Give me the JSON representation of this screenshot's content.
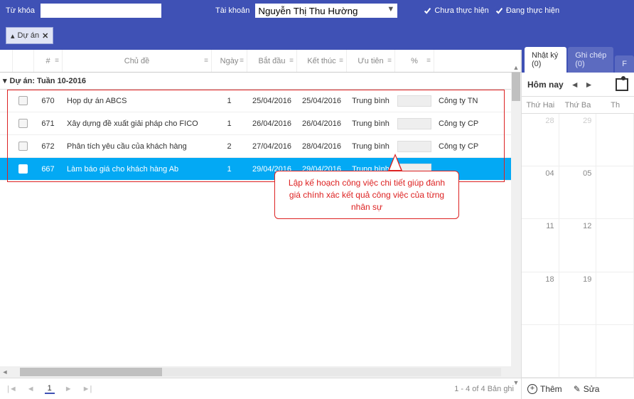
{
  "topbar": {
    "keyword_label": "Từ khóa",
    "keyword_value": "",
    "account_label": "Tài khoản",
    "account_value": "Nguyễn Thị Thu Hường",
    "chk_not_done": "Chưa thực hiện",
    "chk_doing": "Đang thực hiện"
  },
  "group_button": {
    "label": "Dự án",
    "close": "✕"
  },
  "grid": {
    "headers": {
      "id": "#",
      "subject": "Chủ đề",
      "days": "Ngày",
      "start": "Bắt đầu",
      "end": "Kết thúc",
      "priority": "Ưu tiên",
      "pct": "%"
    },
    "group_label": "Dự án: Tuần 10-2016",
    "rows": [
      {
        "id": "670",
        "subject": "Họp dự án ABCS",
        "days": "1",
        "start": "25/04/2016",
        "end": "25/04/2016",
        "priority": "Trung bình",
        "company": "Công ty TN"
      },
      {
        "id": "671",
        "subject": "Xây dựng đề xuất giải pháp cho FICO",
        "days": "1",
        "start": "26/04/2016",
        "end": "26/04/2016",
        "priority": "Trung bình",
        "company": "Công ty CP"
      },
      {
        "id": "672",
        "subject": "Phân tích yêu cầu của khách hàng",
        "days": "2",
        "start": "27/04/2016",
        "end": "28/04/2016",
        "priority": "Trung bình",
        "company": "Công ty CP"
      },
      {
        "id": "667",
        "subject": "Làm báo giá cho khách hàng Ab",
        "days": "1",
        "start": "29/04/2016",
        "end": "29/04/2016",
        "priority": "Trung bình",
        "company": ""
      }
    ]
  },
  "callout": "Lập kế hoạch công việc chi tiết giúp đánh giá chính xác kết quả công việc của từng nhân sự",
  "pager": {
    "current": "1",
    "summary": "1 - 4 of 4 Bản ghi"
  },
  "tabs": {
    "diary": "Nhật ký (0)",
    "notes": "Ghi chép (0)",
    "third": "F"
  },
  "calendar": {
    "today_label": "Hôm nay",
    "day_headers": [
      "Thứ Hai",
      "Thứ Ba",
      "Th"
    ],
    "cells": [
      [
        "28",
        "29",
        ""
      ],
      [
        "04",
        "05",
        ""
      ],
      [
        "11",
        "12",
        ""
      ],
      [
        "18",
        "19",
        ""
      ],
      [
        "",
        "",
        ""
      ]
    ],
    "muted_row": 0
  },
  "actions": {
    "add": "Thêm",
    "edit": "Sửa"
  }
}
